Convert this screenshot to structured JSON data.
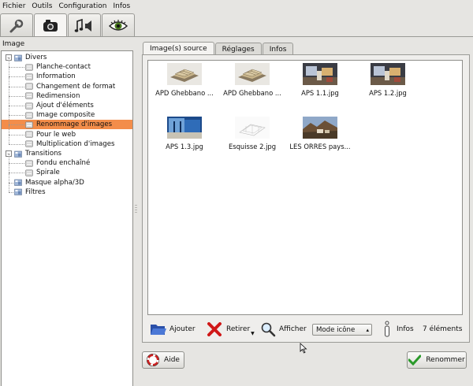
{
  "menu": [
    "Fichier",
    "Outils",
    "Configuration",
    "Infos"
  ],
  "toolbar": {
    "tabs": [
      {
        "name": "tools-tab",
        "icon": "wrench-icon",
        "active": false
      },
      {
        "name": "image-tab",
        "icon": "image-tool-icon",
        "active": true
      },
      {
        "name": "audio-tab",
        "icon": "music-speaker-icon",
        "active": false
      },
      {
        "name": "view-tab",
        "icon": "eye-icon",
        "active": false
      }
    ]
  },
  "left_panel": {
    "title": "Image",
    "tree": [
      {
        "label": "Divers",
        "level": 0,
        "expander": "–",
        "icon": "folder-icon",
        "selected": false
      },
      {
        "label": "Planche-contact",
        "level": 1,
        "icon": "plugin-icon",
        "selected": false
      },
      {
        "label": "Information",
        "level": 1,
        "icon": "plugin-icon",
        "selected": false
      },
      {
        "label": "Changement de format",
        "level": 1,
        "icon": "plugin-icon",
        "selected": false
      },
      {
        "label": "Redimension",
        "level": 1,
        "icon": "plugin-icon",
        "selected": false
      },
      {
        "label": "Ajout d'éléments",
        "level": 1,
        "icon": "plugin-icon",
        "selected": false
      },
      {
        "label": "Image composite",
        "level": 1,
        "icon": "plugin-icon",
        "selected": false
      },
      {
        "label": "Renommage d'images",
        "level": 1,
        "icon": "plugin-icon",
        "selected": true
      },
      {
        "label": "Pour le web",
        "level": 1,
        "icon": "plugin-icon",
        "selected": false
      },
      {
        "label": "Multiplication d'images",
        "level": 1,
        "icon": "plugin-icon",
        "selected": false
      },
      {
        "label": "Transitions",
        "level": 0,
        "expander": "–",
        "icon": "folder-icon",
        "selected": false
      },
      {
        "label": "Fondu enchaîné",
        "level": 1,
        "icon": "plugin-icon",
        "selected": false
      },
      {
        "label": "Spirale",
        "level": 1,
        "icon": "plugin-icon",
        "selected": false
      },
      {
        "label": "Masque alpha/3D",
        "level": 0,
        "icon": "folder-icon",
        "selected": false
      },
      {
        "label": "Filtres",
        "level": 0,
        "icon": "folder-icon",
        "selected": false
      }
    ]
  },
  "tabs": [
    "Image(s) source",
    "Réglages",
    "Infos"
  ],
  "images": [
    {
      "caption": "APD Ghebbano ...",
      "kind": "building-render"
    },
    {
      "caption": "APD Ghebbano ...",
      "kind": "building-render"
    },
    {
      "caption": "APS 1.1.jpg",
      "kind": "interior-photo"
    },
    {
      "caption": "APS 1.2.jpg",
      "kind": "interior-photo"
    },
    {
      "caption": "APS 1.3.jpg",
      "kind": "blue-photo"
    },
    {
      "caption": "Esquisse 2.jpg",
      "kind": "sketch"
    },
    {
      "caption": "LES ORRES pays...",
      "kind": "landscape-photo"
    }
  ],
  "actions": {
    "add": "Ajouter",
    "remove": "Retirer",
    "show": "Afficher",
    "view_mode": "Mode icône",
    "info": "Infos",
    "count": "7 éléments"
  },
  "buttons": {
    "help": "Aide",
    "rename": "Renommer"
  },
  "colors": {
    "selection": "#f38d4a",
    "background": "#e6e5e2"
  }
}
